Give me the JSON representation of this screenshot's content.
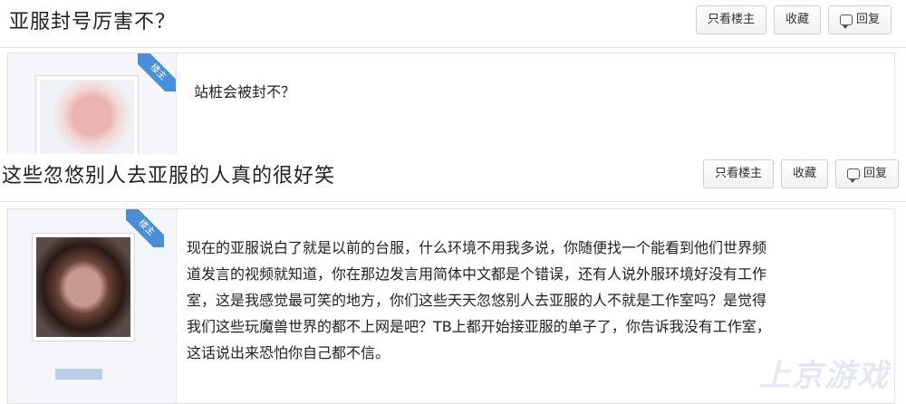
{
  "thread1": {
    "title": "亚服封号厉害不？",
    "buttons": {
      "only_op": "只看楼主",
      "favorite": "收藏",
      "reply": "回复"
    },
    "post": {
      "badge": "楼主",
      "text": "站桩会被封不？"
    }
  },
  "thread2": {
    "title": "这些忽悠别人去亚服的人真的很好笑",
    "buttons": {
      "only_op": "只看楼主",
      "favorite": "收藏",
      "reply": "回复"
    },
    "post": {
      "badge": "楼主",
      "lines": [
        "现在的亚服说白了就是以前的台服，什么环境不用我多说，你随便找一个能看到他们世界频",
        "道发言的视频就知道，你在那边发言用简体中文都是个错误，还有人说外服环境好没有工作",
        "室，这是我感觉最可笑的地方，你们这些天天忽悠别人去亚服的人不就是工作室吗？是觉得",
        "我们这些玩魔兽世界的都不上网是吧？TB上都开始接亚服的单子了，你告诉我没有工作室，",
        "这话说出来恐怕你自己都不信。"
      ]
    }
  },
  "watermark": "上京游戏"
}
